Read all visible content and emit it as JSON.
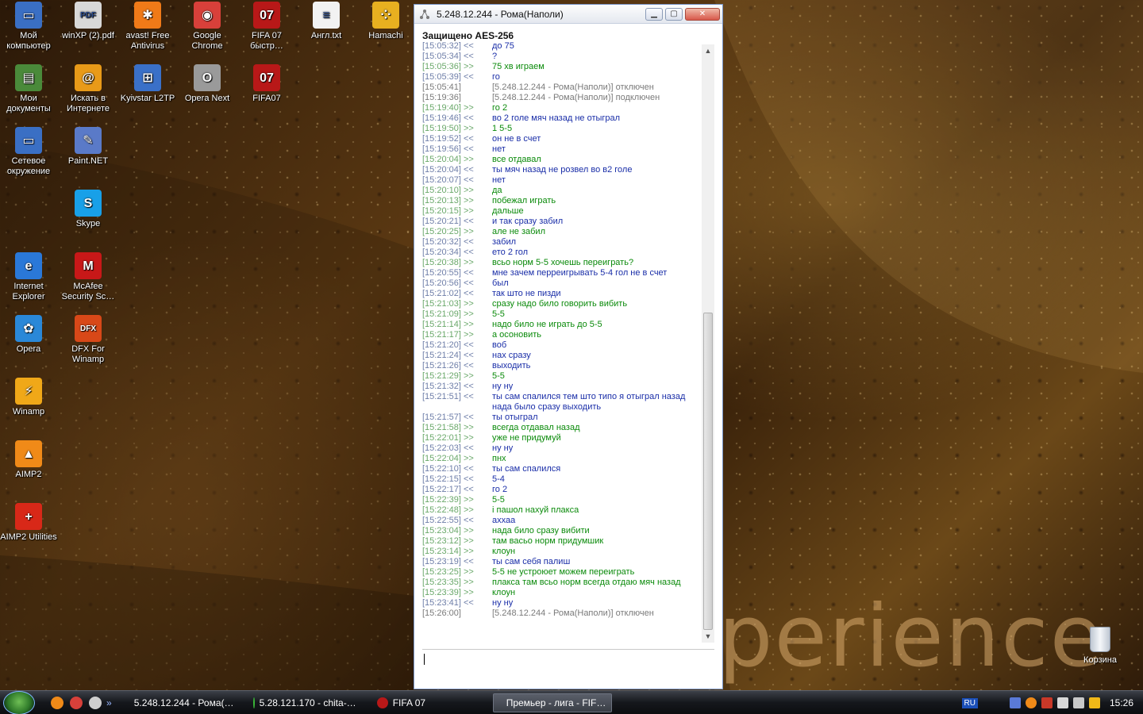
{
  "desktop": {
    "icons": [
      {
        "label": "Мой компьютер",
        "glyph": "▭",
        "color": "#3a6fc4"
      },
      {
        "label": "winXP (2).pdf",
        "glyph": "PDF",
        "color": "#d8d8d8"
      },
      {
        "label": "avast! Free Antivirus",
        "glyph": "✱",
        "color": "#f07a18"
      },
      {
        "label": "Google Chrome",
        "glyph": "◉",
        "color": "#d8403a"
      },
      {
        "label": "FIFA 07 быстр…",
        "glyph": "07",
        "color": "#b81818"
      },
      {
        "label": "Англ.txt",
        "glyph": "≡",
        "color": "#f2f2f2"
      },
      {
        "label": "Hamachi",
        "glyph": "⁘",
        "color": "#e8b020"
      },
      {
        "label": "Мои документы",
        "glyph": "▤",
        "color": "#4a8a3a"
      },
      {
        "label": "Искать в Интернете",
        "glyph": "@",
        "color": "#e89a18"
      },
      {
        "label": "Kyivstar L2TP",
        "glyph": "⊞",
        "color": "#3a70c8"
      },
      {
        "label": "Opera Next",
        "glyph": "O",
        "color": "#9a9a9a"
      },
      {
        "label": "FIFA07",
        "glyph": "07",
        "color": "#b81818"
      },
      {
        "label": "Сетевое окружение",
        "glyph": "▭",
        "color": "#3a6fc4"
      },
      {
        "label": "Paint.NET",
        "glyph": "✎",
        "color": "#5a7ac8"
      },
      {
        "label": "Skype",
        "glyph": "S",
        "color": "#18a0e8"
      },
      {
        "label": "Internet Explorer",
        "glyph": "e",
        "color": "#2a78d8"
      },
      {
        "label": "McAfee Security Sc…",
        "glyph": "M",
        "color": "#c81818"
      },
      {
        "label": "Opera",
        "glyph": "✿",
        "color": "#2a88d8"
      },
      {
        "label": "DFX For Winamp",
        "glyph": "DFX",
        "color": "#d84818"
      },
      {
        "label": "Winamp",
        "glyph": "⚡",
        "color": "#f0a818"
      },
      {
        "label": "AIMP2",
        "glyph": "▲",
        "color": "#f08a18"
      },
      {
        "label": "AIMP2 Utilities",
        "glyph": "+",
        "color": "#d82818"
      }
    ],
    "watermark": "perience",
    "recycle_bin": "Корзина"
  },
  "chat_window": {
    "title": "5.248.12.244 - Рома(Наполи)",
    "secure_label": "Защищено AES-256",
    "messages": [
      {
        "t": "[15:05:32] <<",
        "text": "до 75",
        "kind": "in"
      },
      {
        "t": "[15:05:34] <<",
        "text": "?",
        "kind": "in"
      },
      {
        "t": "[15:05:36] >>",
        "text": "75 хв играем",
        "kind": "out"
      },
      {
        "t": "[15:05:39] <<",
        "text": "го",
        "kind": "in"
      },
      {
        "t": "[15:05:41]",
        "text": "[5.248.12.244 - Рома(Наполи)] отключен",
        "kind": "sys"
      },
      {
        "t": "[15:19:36]",
        "text": "[5.248.12.244 - Рома(Наполи)] подключен",
        "kind": "sys"
      },
      {
        "t": "[15:19:40] >>",
        "text": "го 2",
        "kind": "out"
      },
      {
        "t": "[15:19:46] <<",
        "text": "во 2 голе мяч назад не отыграл",
        "kind": "in"
      },
      {
        "t": "[15:19:50] >>",
        "text": "1    5-5",
        "kind": "out"
      },
      {
        "t": "[15:19:52] <<",
        "text": "он не в счет",
        "kind": "in"
      },
      {
        "t": "[15:19:56] <<",
        "text": "нет",
        "kind": "in"
      },
      {
        "t": "[15:20:04] >>",
        "text": "все отдавал",
        "kind": "out"
      },
      {
        "t": "[15:20:04] <<",
        "text": "ты мяч назад не розвел во в2 голе",
        "kind": "in"
      },
      {
        "t": "[15:20:07] <<",
        "text": "нет",
        "kind": "in"
      },
      {
        "t": "[15:20:10] >>",
        "text": "да",
        "kind": "out"
      },
      {
        "t": "[15:20:13] >>",
        "text": "побежал играть",
        "kind": "out"
      },
      {
        "t": "[15:20:15] >>",
        "text": "дальше",
        "kind": "out"
      },
      {
        "t": "[15:20:21] <<",
        "text": "и так сразу забил",
        "kind": "in"
      },
      {
        "t": "[15:20:25] >>",
        "text": "але не забил",
        "kind": "out"
      },
      {
        "t": "[15:20:32] <<",
        "text": "забил",
        "kind": "in"
      },
      {
        "t": "[15:20:34] <<",
        "text": "ето 2 гол",
        "kind": "in"
      },
      {
        "t": "[15:20:38] >>",
        "text": "всьо норм 5-5  хочешь переиграть?",
        "kind": "out"
      },
      {
        "t": "[15:20:55] <<",
        "text": "мне зачем перреигрывать 5-4 гол не в счет",
        "kind": "in"
      },
      {
        "t": "[15:20:56] <<",
        "text": "был",
        "kind": "in"
      },
      {
        "t": "[15:21:02] <<",
        "text": "так што не пизди",
        "kind": "in"
      },
      {
        "t": "[15:21:03] >>",
        "text": "сразу надо било говорить вибить",
        "kind": "out"
      },
      {
        "t": "[15:21:09] >>",
        "text": "5-5",
        "kind": "out"
      },
      {
        "t": "[15:21:14] >>",
        "text": "надо било не играть до 5-5",
        "kind": "out"
      },
      {
        "t": "[15:21:17] >>",
        "text": "а осоновить",
        "kind": "out"
      },
      {
        "t": "[15:21:20] <<",
        "text": "воб",
        "kind": "in"
      },
      {
        "t": "[15:21:24] <<",
        "text": "нах сразу",
        "kind": "in"
      },
      {
        "t": "[15:21:26] <<",
        "text": "выходить",
        "kind": "in"
      },
      {
        "t": "[15:21:29] >>",
        "text": "5-5",
        "kind": "out"
      },
      {
        "t": "[15:21:32] <<",
        "text": "ну ну",
        "kind": "in"
      },
      {
        "t": "[15:21:51] <<",
        "text": "ты сам спалился тем што типо я отыграл назад нада было сразу выходить",
        "kind": "in"
      },
      {
        "t": "[15:21:57] <<",
        "text": "ты отыграл",
        "kind": "in"
      },
      {
        "t": "[15:21:58] >>",
        "text": "всегда отдавал назад",
        "kind": "out"
      },
      {
        "t": "[15:22:01] >>",
        "text": "уже не придумуй",
        "kind": "out"
      },
      {
        "t": "[15:22:03] <<",
        "text": "ну ну",
        "kind": "in"
      },
      {
        "t": "[15:22:04] >>",
        "text": "пнх",
        "kind": "out"
      },
      {
        "t": "[15:22:10] <<",
        "text": "ты сам спалился",
        "kind": "in"
      },
      {
        "t": "[15:22:15] <<",
        "text": "5-4",
        "kind": "in"
      },
      {
        "t": "[15:22:17] <<",
        "text": "го 2",
        "kind": "in"
      },
      {
        "t": "[15:22:39] >>",
        "text": "5-5",
        "kind": "out"
      },
      {
        "t": "[15:22:48] >>",
        "text": "і пашол нахуй плакса",
        "kind": "out"
      },
      {
        "t": "[15:22:55] <<",
        "text": "аххаа",
        "kind": "in"
      },
      {
        "t": "[15:23:04] >>",
        "text": "нада било сразу вибити",
        "kind": "out"
      },
      {
        "t": "[15:23:12] >>",
        "text": "там васьо норм придумшик",
        "kind": "out"
      },
      {
        "t": "[15:23:14] >>",
        "text": "клоун",
        "kind": "out"
      },
      {
        "t": "[15:23:19] <<",
        "text": "ты сам себя палиш",
        "kind": "in"
      },
      {
        "t": "[15:23:25] >>",
        "text": "5-5 не устроюет можем переиграть",
        "kind": "out"
      },
      {
        "t": "[15:23:35] >>",
        "text": "плакса там всьо норм всегда отдаю мяч назад",
        "kind": "out"
      },
      {
        "t": "[15:23:39] >>",
        "text": "клоун",
        "kind": "out"
      },
      {
        "t": "[15:23:41] <<",
        "text": "ну ну",
        "kind": "in"
      },
      {
        "t": "[15:26:00]",
        "text": "[5.248.12.244 - Рома(Наполи)] отключен",
        "kind": "sys"
      }
    ],
    "input_value": ""
  },
  "taskbar": {
    "quick_launch": [
      {
        "name": "aimp-quicklaunch-icon",
        "color": "#f08a18"
      },
      {
        "name": "chrome-quicklaunch-icon",
        "color": "#d8403a"
      },
      {
        "name": "opera-quicklaunch-icon",
        "color": "#cfcfcf"
      }
    ],
    "tasks": [
      {
        "label": "5.248.12.244 - Рома(…",
        "icon_color": "#8a8a8a",
        "active": false
      },
      {
        "label": "5.28.121.170 - chita-…",
        "icon_color": "#3ab838",
        "active": false
      },
      {
        "label": "FIFA 07",
        "icon_color": "#b81818",
        "active": false
      },
      {
        "label": "Премьер - лига - FIF…",
        "icon_color": "#ffffff",
        "active": true
      }
    ],
    "language": "RU",
    "clock": "15:26"
  }
}
